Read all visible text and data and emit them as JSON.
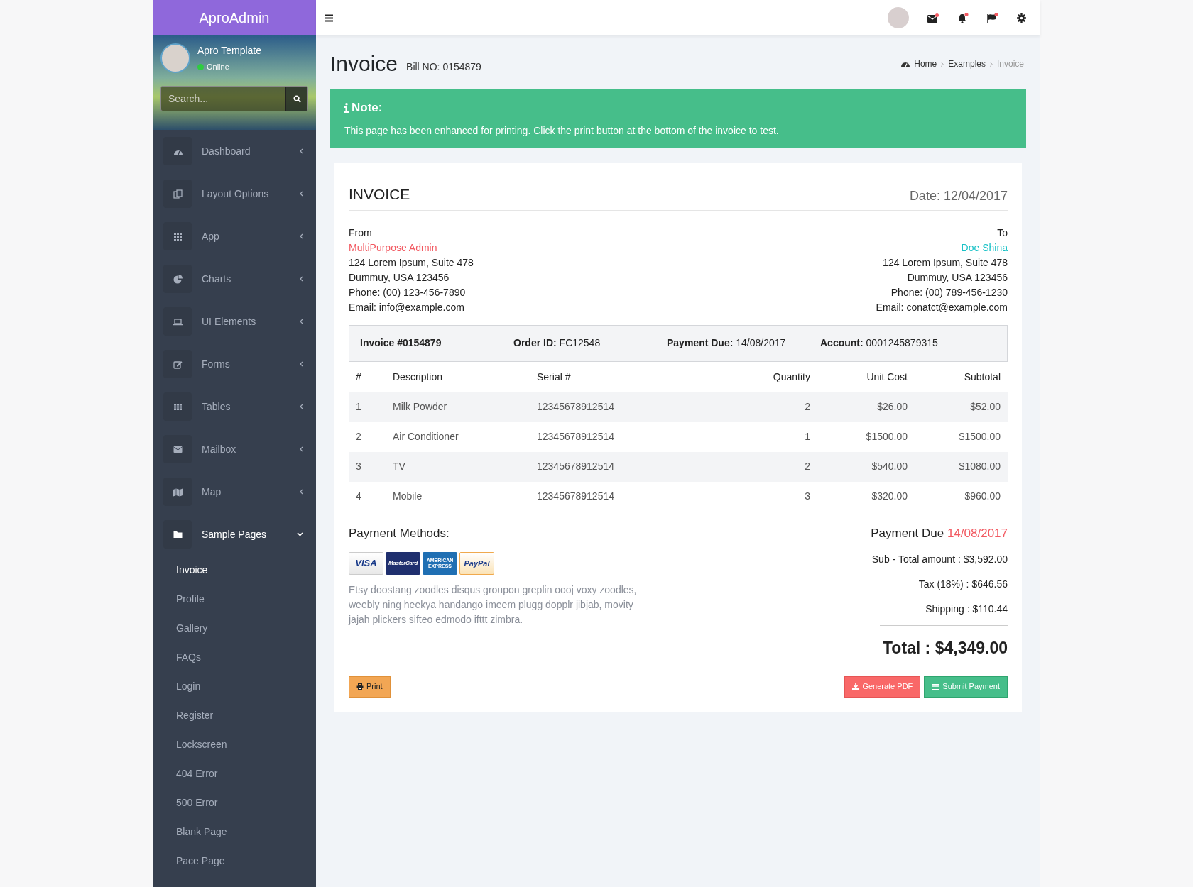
{
  "brand": "AproAdmin",
  "user": {
    "name": "Apro Template",
    "status": "Online"
  },
  "sidebar_search": {
    "placeholder": "Search..."
  },
  "menu": [
    {
      "label": "Dashboard",
      "expanded": false
    },
    {
      "label": "Layout Options",
      "expanded": false
    },
    {
      "label": "App",
      "expanded": false
    },
    {
      "label": "Charts",
      "expanded": false
    },
    {
      "label": "UI Elements",
      "expanded": false
    },
    {
      "label": "Forms",
      "expanded": false
    },
    {
      "label": "Tables",
      "expanded": false
    },
    {
      "label": "Mailbox",
      "expanded": false
    },
    {
      "label": "Map",
      "expanded": false
    },
    {
      "label": "Sample Pages",
      "expanded": true,
      "children": [
        {
          "label": "Invoice",
          "selected": true
        },
        {
          "label": "Profile",
          "selected": false
        },
        {
          "label": "Gallery",
          "selected": false
        },
        {
          "label": "FAQs",
          "selected": false
        },
        {
          "label": "Login",
          "selected": false
        },
        {
          "label": "Register",
          "selected": false
        },
        {
          "label": "Lockscreen",
          "selected": false
        },
        {
          "label": "404 Error",
          "selected": false
        },
        {
          "label": "500 Error",
          "selected": false
        },
        {
          "label": "Blank Page",
          "selected": false
        },
        {
          "label": "Pace Page",
          "selected": false
        }
      ]
    }
  ],
  "page": {
    "title": "Invoice",
    "subtitle": "Bill NO: 0154879"
  },
  "breadcrumb": [
    {
      "label": "Home",
      "selected": false
    },
    {
      "label": "Examples",
      "selected": false
    },
    {
      "label": "Invoice",
      "selected": true
    }
  ],
  "alert": {
    "title": "Note:",
    "text": "This page has been enhanced for printing. Click the print button at the bottom of the invoice to test."
  },
  "invoice": {
    "heading": "INVOICE",
    "date": "Date: 12/04/2017",
    "from": {
      "label": "From",
      "name": "MultiPurpose Admin",
      "lines": [
        "124 Lorem Ipsum, Suite 478",
        "Dummuy, USA 123456",
        "Phone: (00) 123-456-7890",
        "Email: info@example.com"
      ]
    },
    "to": {
      "label": "To",
      "name": "Doe Shina",
      "lines": [
        "124 Lorem Ipsum, Suite 478",
        "Dummuy, USA 123456",
        "Phone: (00) 789-456-1230",
        "Email: conatct@example.com"
      ]
    },
    "info": [
      {
        "label": "Invoice #0154879"
      },
      {
        "label": "Order ID:",
        "value": "FC12548"
      },
      {
        "label": "Payment Due:",
        "value": "14/08/2017"
      },
      {
        "label": "Account:",
        "value": "0001245879315"
      }
    ],
    "table": {
      "columns": [
        "#",
        "Description",
        "Serial #",
        "Quantity",
        "Unit Cost",
        "Subtotal"
      ],
      "rows": [
        [
          "1",
          "Milk Powder",
          "12345678912514",
          "2",
          "$26.00",
          "$52.00"
        ],
        [
          "2",
          "Air Conditioner",
          "12345678912514",
          "1",
          "$1500.00",
          "$1500.00"
        ],
        [
          "3",
          "TV",
          "12345678912514",
          "2",
          "$540.00",
          "$1080.00"
        ],
        [
          "4",
          "Mobile",
          "12345678912514",
          "3",
          "$320.00",
          "$960.00"
        ]
      ]
    },
    "payment_methods": {
      "title": "Payment Methods:",
      "cards": [
        "VISA",
        "MasterCard",
        "AMERICAN EXPRESS",
        "PayPal"
      ],
      "note": "Etsy doostang zoodles disqus groupon greplin oooj voxy zoodles, weebly ning heekya handango imeem plugg dopplr jibjab, movity jajah plickers sifteo edmodo ifttt zimbra."
    },
    "totals": {
      "due_label": "Payment Due",
      "due_date": "14/08/2017",
      "lines": [
        "Sub - Total amount : $3,592.00",
        "Tax (18%) : $646.56",
        "Shipping : $110.44"
      ],
      "total": "Total : $4,349.00"
    },
    "buttons": [
      "Print",
      "Generate PDF",
      "Submit Payment"
    ]
  }
}
